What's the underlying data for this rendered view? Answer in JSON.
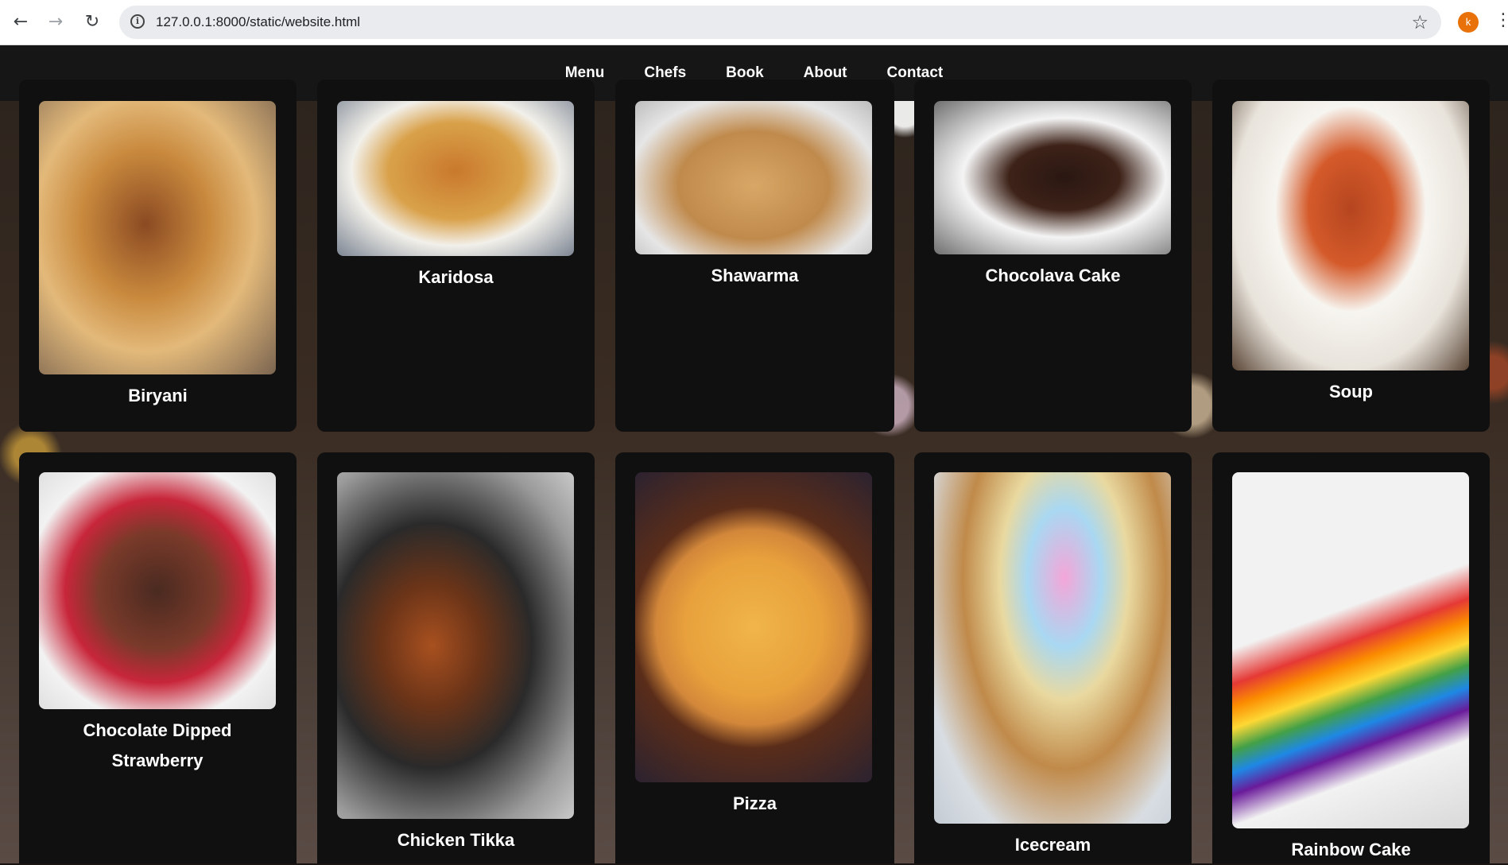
{
  "browser": {
    "url": "127.0.0.1:8000/static/website.html",
    "profile_initial": "k"
  },
  "nav": {
    "items": [
      "Menu",
      "Chefs",
      "Book",
      "About",
      "Contact"
    ]
  },
  "dishes": {
    "row1": [
      "Biryani",
      "Karidosa",
      "Shawarma",
      "Chocolava Cake",
      "Soup"
    ],
    "row2": [
      "Chocolate Dipped Strawberry",
      "Chicken Tikka",
      "Pizza",
      "Icecream",
      "Rainbow Cake"
    ]
  }
}
